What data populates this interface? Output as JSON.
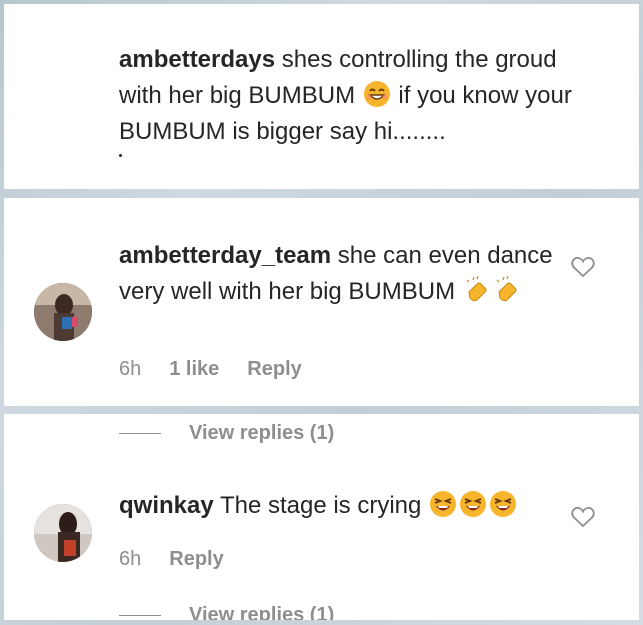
{
  "comments": [
    {
      "username": "ambetterdays",
      "text_part1": " shes controlling the groud with her big BUMBUM ",
      "text_part2": " if you know your BUMBUM is bigger say hi........"
    },
    {
      "username": "ambetterday_team",
      "text": " she can even dance very well with her big BUMBUM ",
      "time": "6h",
      "likes": "1 like",
      "reply_label": "Reply"
    },
    {
      "username": "qwinkay",
      "text": " The stage is crying ",
      "time": "6h",
      "reply_label": "Reply"
    }
  ],
  "view_replies": {
    "first": "View replies (1)",
    "second": "View replies (1)"
  },
  "icons": {
    "heart": "heart-outline-icon",
    "smile": "grinning-face-emoji",
    "clap": "clapping-hands-emoji",
    "laugh": "squinting-laugh-emoji"
  },
  "colors": {
    "text": "#262626",
    "meta": "#8e8e8e",
    "background": "#c3ced6"
  }
}
